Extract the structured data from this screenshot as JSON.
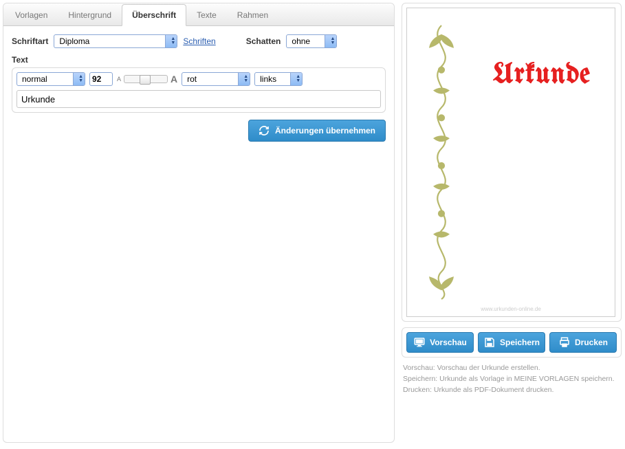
{
  "tabs": [
    {
      "label": "Vorlagen",
      "active": false
    },
    {
      "label": "Hintergrund",
      "active": false
    },
    {
      "label": "Überschrift",
      "active": true
    },
    {
      "label": "Texte",
      "active": false
    },
    {
      "label": "Rahmen",
      "active": false
    }
  ],
  "font": {
    "label": "Schriftart",
    "value": "Diploma",
    "link": "Schriften"
  },
  "shadow": {
    "label": "Schatten",
    "value": "ohne"
  },
  "text_section": {
    "label": "Text",
    "weight": "normal",
    "size": "92",
    "color": "rot",
    "align": "links",
    "value": "Urkunde"
  },
  "apply_button": "Änderungen übernehmen",
  "preview": {
    "title": "Urkunde",
    "watermark": "www.urkunden-online.de"
  },
  "actions": {
    "preview": "Vorschau",
    "save": "Speichern",
    "print": "Drucken"
  },
  "help": {
    "line1": "Vorschau: Vorschau der Urkunde erstellen.",
    "line2": "Speichern: Urkunde als Vorlage in MEINE VORLAGEN speichern.",
    "line3": "Drucken: Urkunde als PDF-Dokument drucken."
  }
}
